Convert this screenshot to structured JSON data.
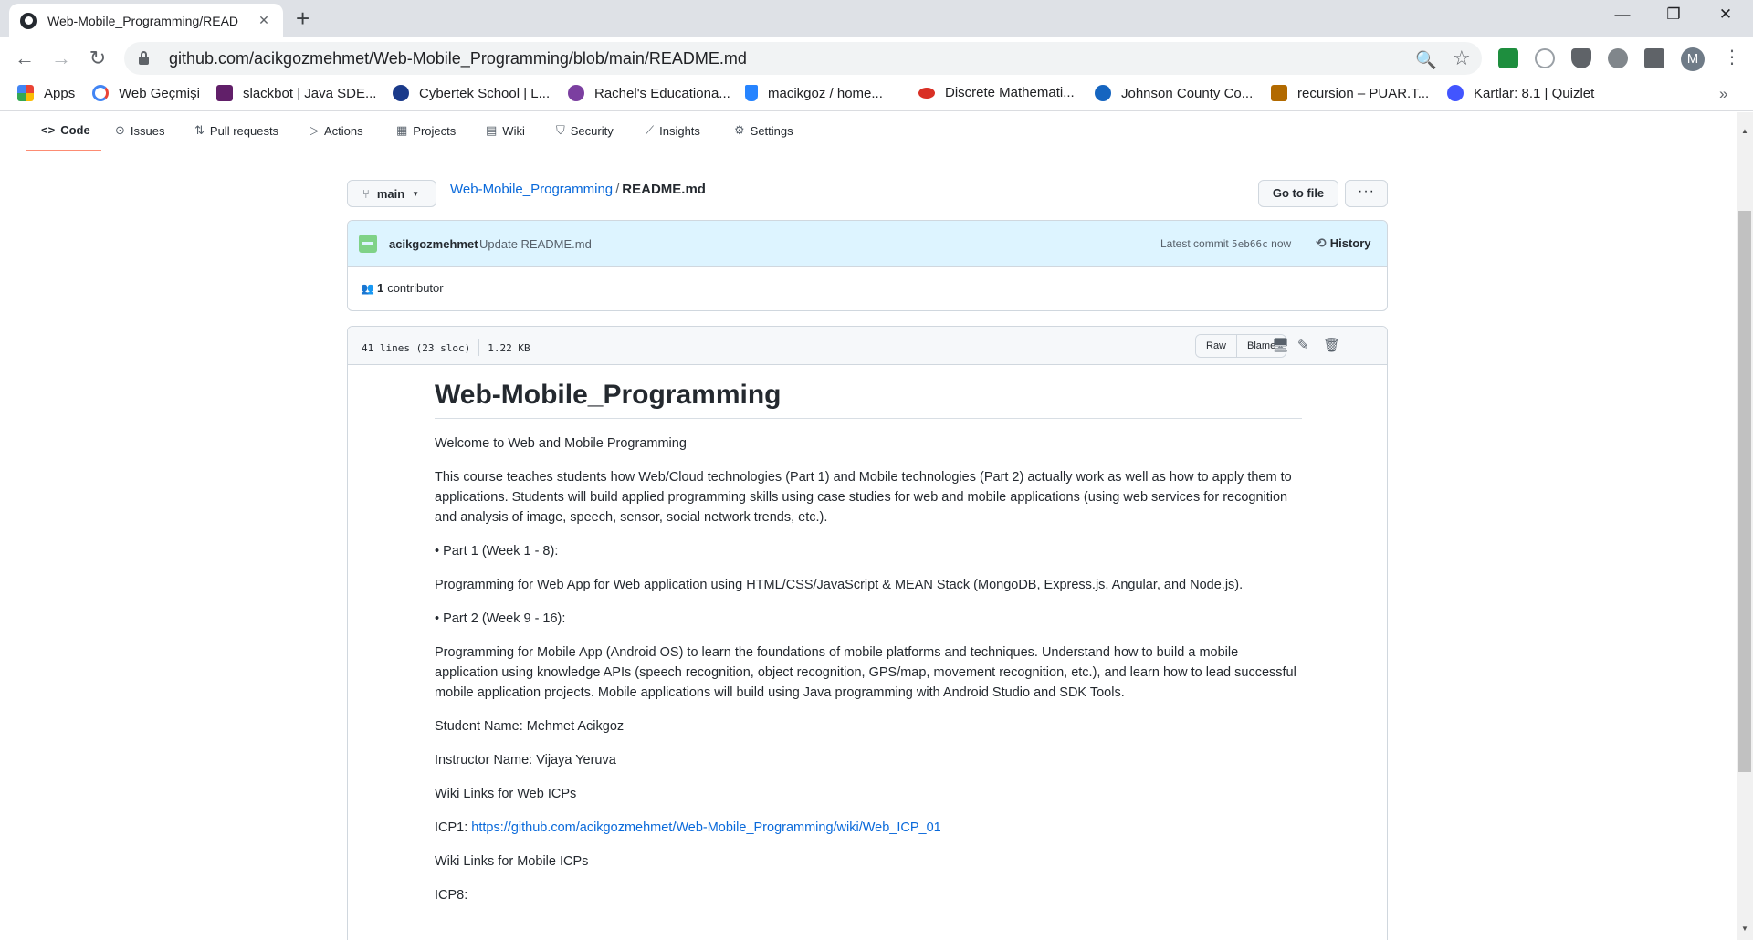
{
  "browser": {
    "tab_title": "Web-Mobile_Programming/READ",
    "tab_close": "✕",
    "new_tab": "+",
    "url": "github.com/acikgozmehmet/Web-Mobile_Programming/blob/main/README.md",
    "profile_initial": "M",
    "window_controls": {
      "minimize": "—",
      "restore": "❐",
      "close": "✕"
    },
    "nav_icons": {
      "back": "←",
      "forward": "→",
      "reload": "↻",
      "zoom": "🔍",
      "star": "☆",
      "kebab": "⋮"
    },
    "bookmarks": [
      {
        "label": "Apps",
        "icon": "apps-grid-icon",
        "color": "#ea4335"
      },
      {
        "label": "Web Geçmişi",
        "icon": "google-icon",
        "color": "#4285f4"
      },
      {
        "label": "slackbot | Java SDE...",
        "icon": "slack-icon",
        "color": "#611f69"
      },
      {
        "label": "Cybertek School | L...",
        "icon": "cybertek-icon",
        "color": "#1a3a8a"
      },
      {
        "label": "Rachel's Educationa...",
        "icon": "rachel-icon",
        "color": "#7b3fa0"
      },
      {
        "label": "macikgoz / home...",
        "icon": "bitbucket-icon",
        "color": "#2684ff"
      },
      {
        "label": "Discrete Mathemati...",
        "icon": "discrete-icon",
        "color": "#d93025"
      },
      {
        "label": "Johnson County Co...",
        "icon": "jccc-icon",
        "color": "#1565c0"
      },
      {
        "label": "recursion – PUAR.T...",
        "icon": "puar-icon",
        "color": "#b26a00"
      },
      {
        "label": "Kartlar: 8.1 | Quizlet",
        "icon": "quizlet-icon",
        "color": "#4255ff"
      }
    ],
    "bookmarks_more": "»"
  },
  "repo_nav": [
    {
      "label": "Code",
      "icon": "<>"
    },
    {
      "label": "Issues",
      "icon": "⊙"
    },
    {
      "label": "Pull requests",
      "icon": "⇅"
    },
    {
      "label": "Actions",
      "icon": "▷"
    },
    {
      "label": "Projects",
      "icon": "▦"
    },
    {
      "label": "Wiki",
      "icon": "▤"
    },
    {
      "label": "Security",
      "icon": "⛉"
    },
    {
      "label": "Insights",
      "icon": "⟋"
    },
    {
      "label": "Settings",
      "icon": "⚙"
    }
  ],
  "file_header": {
    "branch": "main",
    "branch_icon": "⑂",
    "repo_link": "Web-Mobile_Programming",
    "separator": "/",
    "file_name": "README.md",
    "goto_file": "Go to file",
    "more": "···"
  },
  "commit": {
    "author": "acikgozmehmet",
    "message": "Update README.md",
    "latest_label": "Latest commit",
    "sha": "5eb66c",
    "time": "now",
    "history_label": "History",
    "contributors_count": "1",
    "contributors_label": "contributor"
  },
  "file": {
    "lines": "41 lines (23 sloc)",
    "size": "1.22 KB",
    "raw": "Raw",
    "blame": "Blame"
  },
  "readme": {
    "title": "Web-Mobile_Programming",
    "p1": "Welcome to Web and Mobile Programming",
    "p2": "This course teaches students how Web/Cloud technologies (Part 1) and Mobile technologies (Part 2) actually work as well as how to apply them to applications. Students will build applied programming skills using case studies for web and mobile applications (using web services for recognition and analysis of image, speech, sensor, social network trends, etc.).",
    "p3": "• Part 1 (Week 1 - 8):",
    "p4": "Programming for Web App for Web application using HTML/CSS/JavaScript & MEAN Stack (MongoDB, Express.js, Angular, and Node.js).",
    "p5": "• Part 2 (Week 9 - 16):",
    "p6": "Programming for Mobile App (Android OS) to learn the foundations of mobile platforms and techniques. Understand how to build a mobile application using knowledge APIs (speech recognition, object recognition, GPS/map, movement recognition, etc.), and learn how to lead successful mobile application projects. Mobile applications will build using Java programming with Android Studio and SDK Tools.",
    "p7": "Student Name: Mehmet Acikgoz",
    "p8": "Instructor Name: Vijaya Yeruva",
    "p9": "Wiki Links for Web ICPs",
    "icp1_label": "ICP1:",
    "icp1_link": "https://github.com/acikgozmehmet/Web-Mobile_Programming/wiki/Web_ICP_01",
    "p10": "Wiki Links for Mobile ICPs",
    "p11": "ICP8:"
  }
}
